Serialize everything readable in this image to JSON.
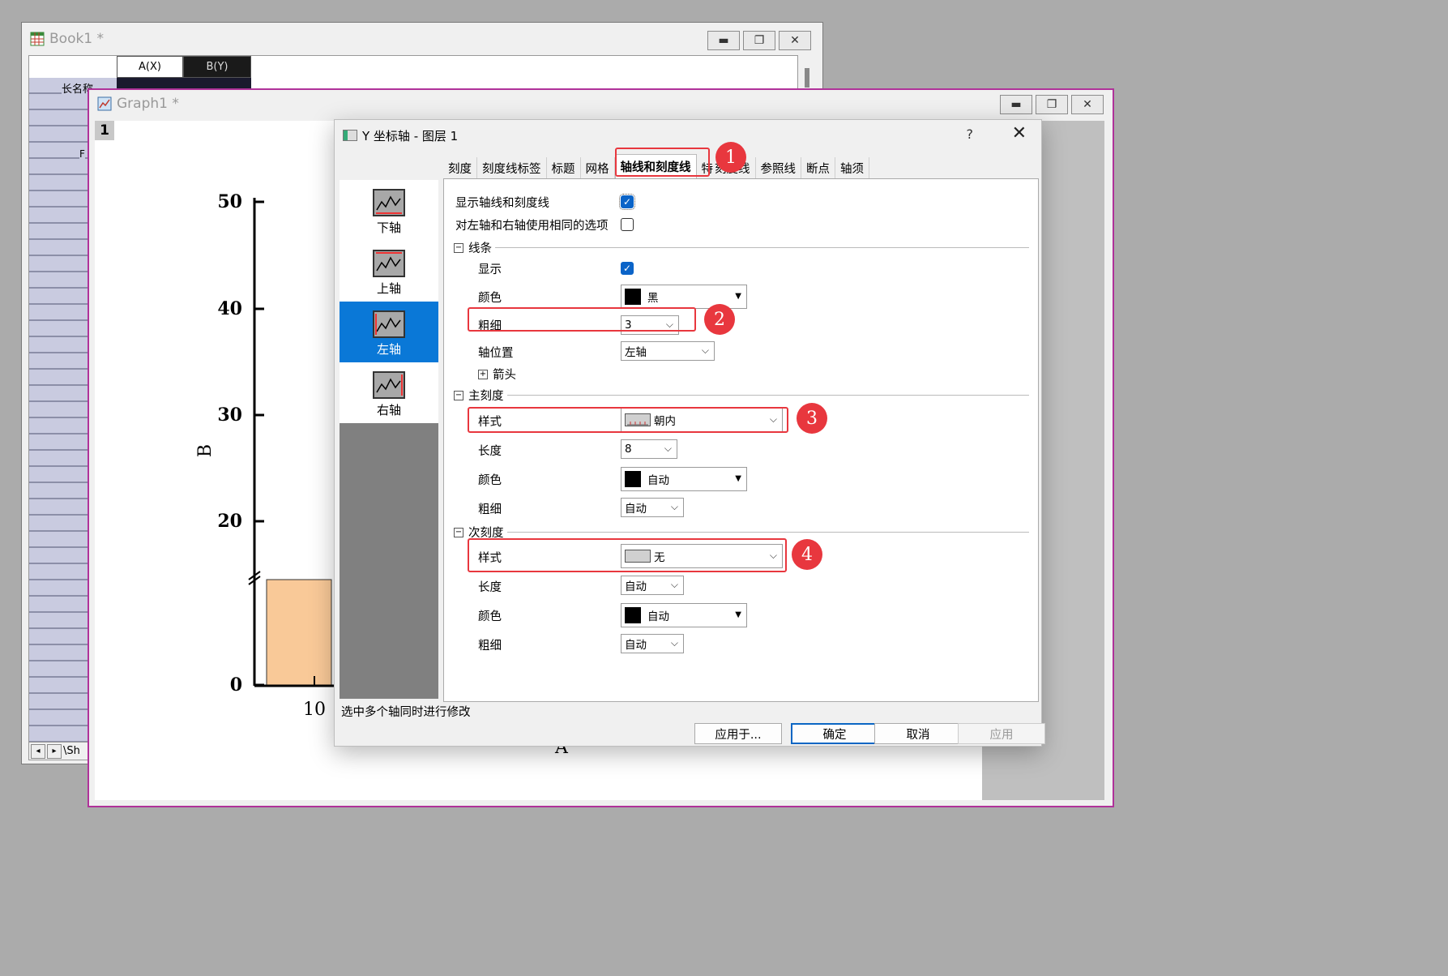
{
  "book_window": {
    "title": "Book1 *",
    "columns": [
      "A(X)",
      "B(Y)"
    ],
    "row_labels": [
      "长名称",
      "F"
    ],
    "sheet_tab": "Sh"
  },
  "graph_window": {
    "title": "Graph1 *",
    "layer_number": "1"
  },
  "plot": {
    "y_label": "B",
    "x_label": "A",
    "y_ticks": [
      "50",
      "40",
      "30",
      "20",
      "0"
    ],
    "x_ticks": [
      "10"
    ],
    "bar_color": "#f9c998"
  },
  "dialog": {
    "title": "Y 坐标轴 - 图层 1",
    "help": "?",
    "close": "✕",
    "tabs": [
      "刻度",
      "刻度线标签",
      "标题",
      "网格",
      "轴线和刻度线",
      "特",
      "刻度线",
      "参照线",
      "断点",
      "轴须"
    ],
    "active_tab": "轴线和刻度线",
    "axes": [
      "下轴",
      "上轴",
      "左轴",
      "右轴"
    ],
    "selected_axis": "左轴",
    "show_axes_label": "显示轴线和刻度线",
    "same_options_label": "对左轴和右轴使用相同的选项",
    "line_section": {
      "title": "线条",
      "show_label": "显示",
      "color_label": "颜色",
      "color_value": "黑",
      "thickness_label": "粗细",
      "thickness_value": "3",
      "position_label": "轴位置",
      "position_value": "左轴",
      "arrow_label": "箭头"
    },
    "major_section": {
      "title": "主刻度",
      "style_label": "样式",
      "style_value": "朝内",
      "length_label": "长度",
      "length_value": "8",
      "color_label": "颜色",
      "color_value": "自动",
      "thickness_label": "粗细",
      "thickness_value": "自动"
    },
    "minor_section": {
      "title": "次刻度",
      "style_label": "样式",
      "style_value": "无",
      "length_label": "长度",
      "length_value": "自动",
      "color_label": "颜色",
      "color_value": "自动",
      "thickness_label": "粗细",
      "thickness_value": "自动"
    },
    "status_text": "选中多个轴同时进行修改",
    "buttons": {
      "apply_to": "应用于...",
      "ok": "确定",
      "cancel": "取消",
      "apply": "应用"
    },
    "callouts": [
      "1",
      "2",
      "3",
      "4"
    ],
    "callout_color": "#e8373e",
    "selection_color": "#0a78d7"
  }
}
